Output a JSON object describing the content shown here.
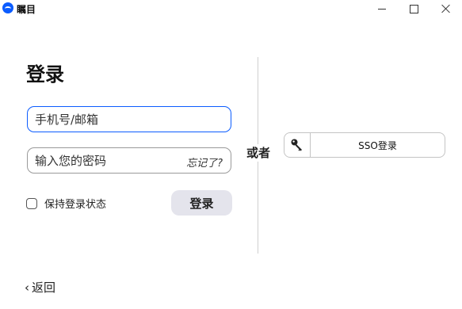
{
  "window": {
    "title": "瞩目",
    "controls": [
      "minimize",
      "maximize",
      "close"
    ]
  },
  "login": {
    "heading": "登录",
    "email_placeholder": "手机号/邮箱",
    "password_placeholder": "输入您的密码",
    "forgot_label": "忘记了?",
    "remember_label": "保持登录状态",
    "remember_checked": false,
    "submit_label": "登录"
  },
  "divider": {
    "or_label": "或者"
  },
  "sso": {
    "label": "SSO登录",
    "icon": "key-icon"
  },
  "footer": {
    "back_label": "返回",
    "back_icon": "chevron-left-icon"
  },
  "colors": {
    "accent": "#0b5cff",
    "button_bg": "#e4e4ec",
    "border": "#c4c4c4"
  }
}
